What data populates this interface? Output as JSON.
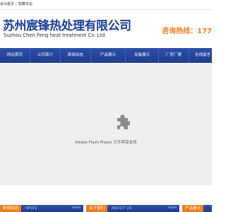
{
  "topbar": {
    "set_home": "设为首页",
    "separator": "|",
    "bookmark": "收藏本站"
  },
  "header": {
    "company_cn": "苏州宸锋热处理有限公司",
    "company_en": "Suzhou Chen Feng heat treatment Co. Ltd.",
    "hotline": "咨询热线：177"
  },
  "nav": {
    "items": [
      {
        "label": "网站首页"
      },
      {
        "label": "公司简介"
      },
      {
        "label": "新闻动态"
      },
      {
        "label": "产品展示"
      },
      {
        "label": "设备展示"
      },
      {
        "label": "厂房厂貌"
      },
      {
        "label": "在线留言"
      }
    ]
  },
  "banner": {
    "plugin_icon": "puzzle-piece-icon",
    "message": "Adobe Flash Player 已不再受支持"
  },
  "panels": {
    "news": {
      "title": "新闻动态",
      "en": "NEWS",
      "more": "more"
    },
    "about": {
      "title": "关于我们",
      "en": "ABOUT US",
      "more": "more"
    },
    "products": {
      "title": "产品展示"
    }
  },
  "colors": {
    "brand_blue": "#1e3d91",
    "accent_orange": "#f07d1c",
    "banner_bg": "#eeeeee"
  }
}
